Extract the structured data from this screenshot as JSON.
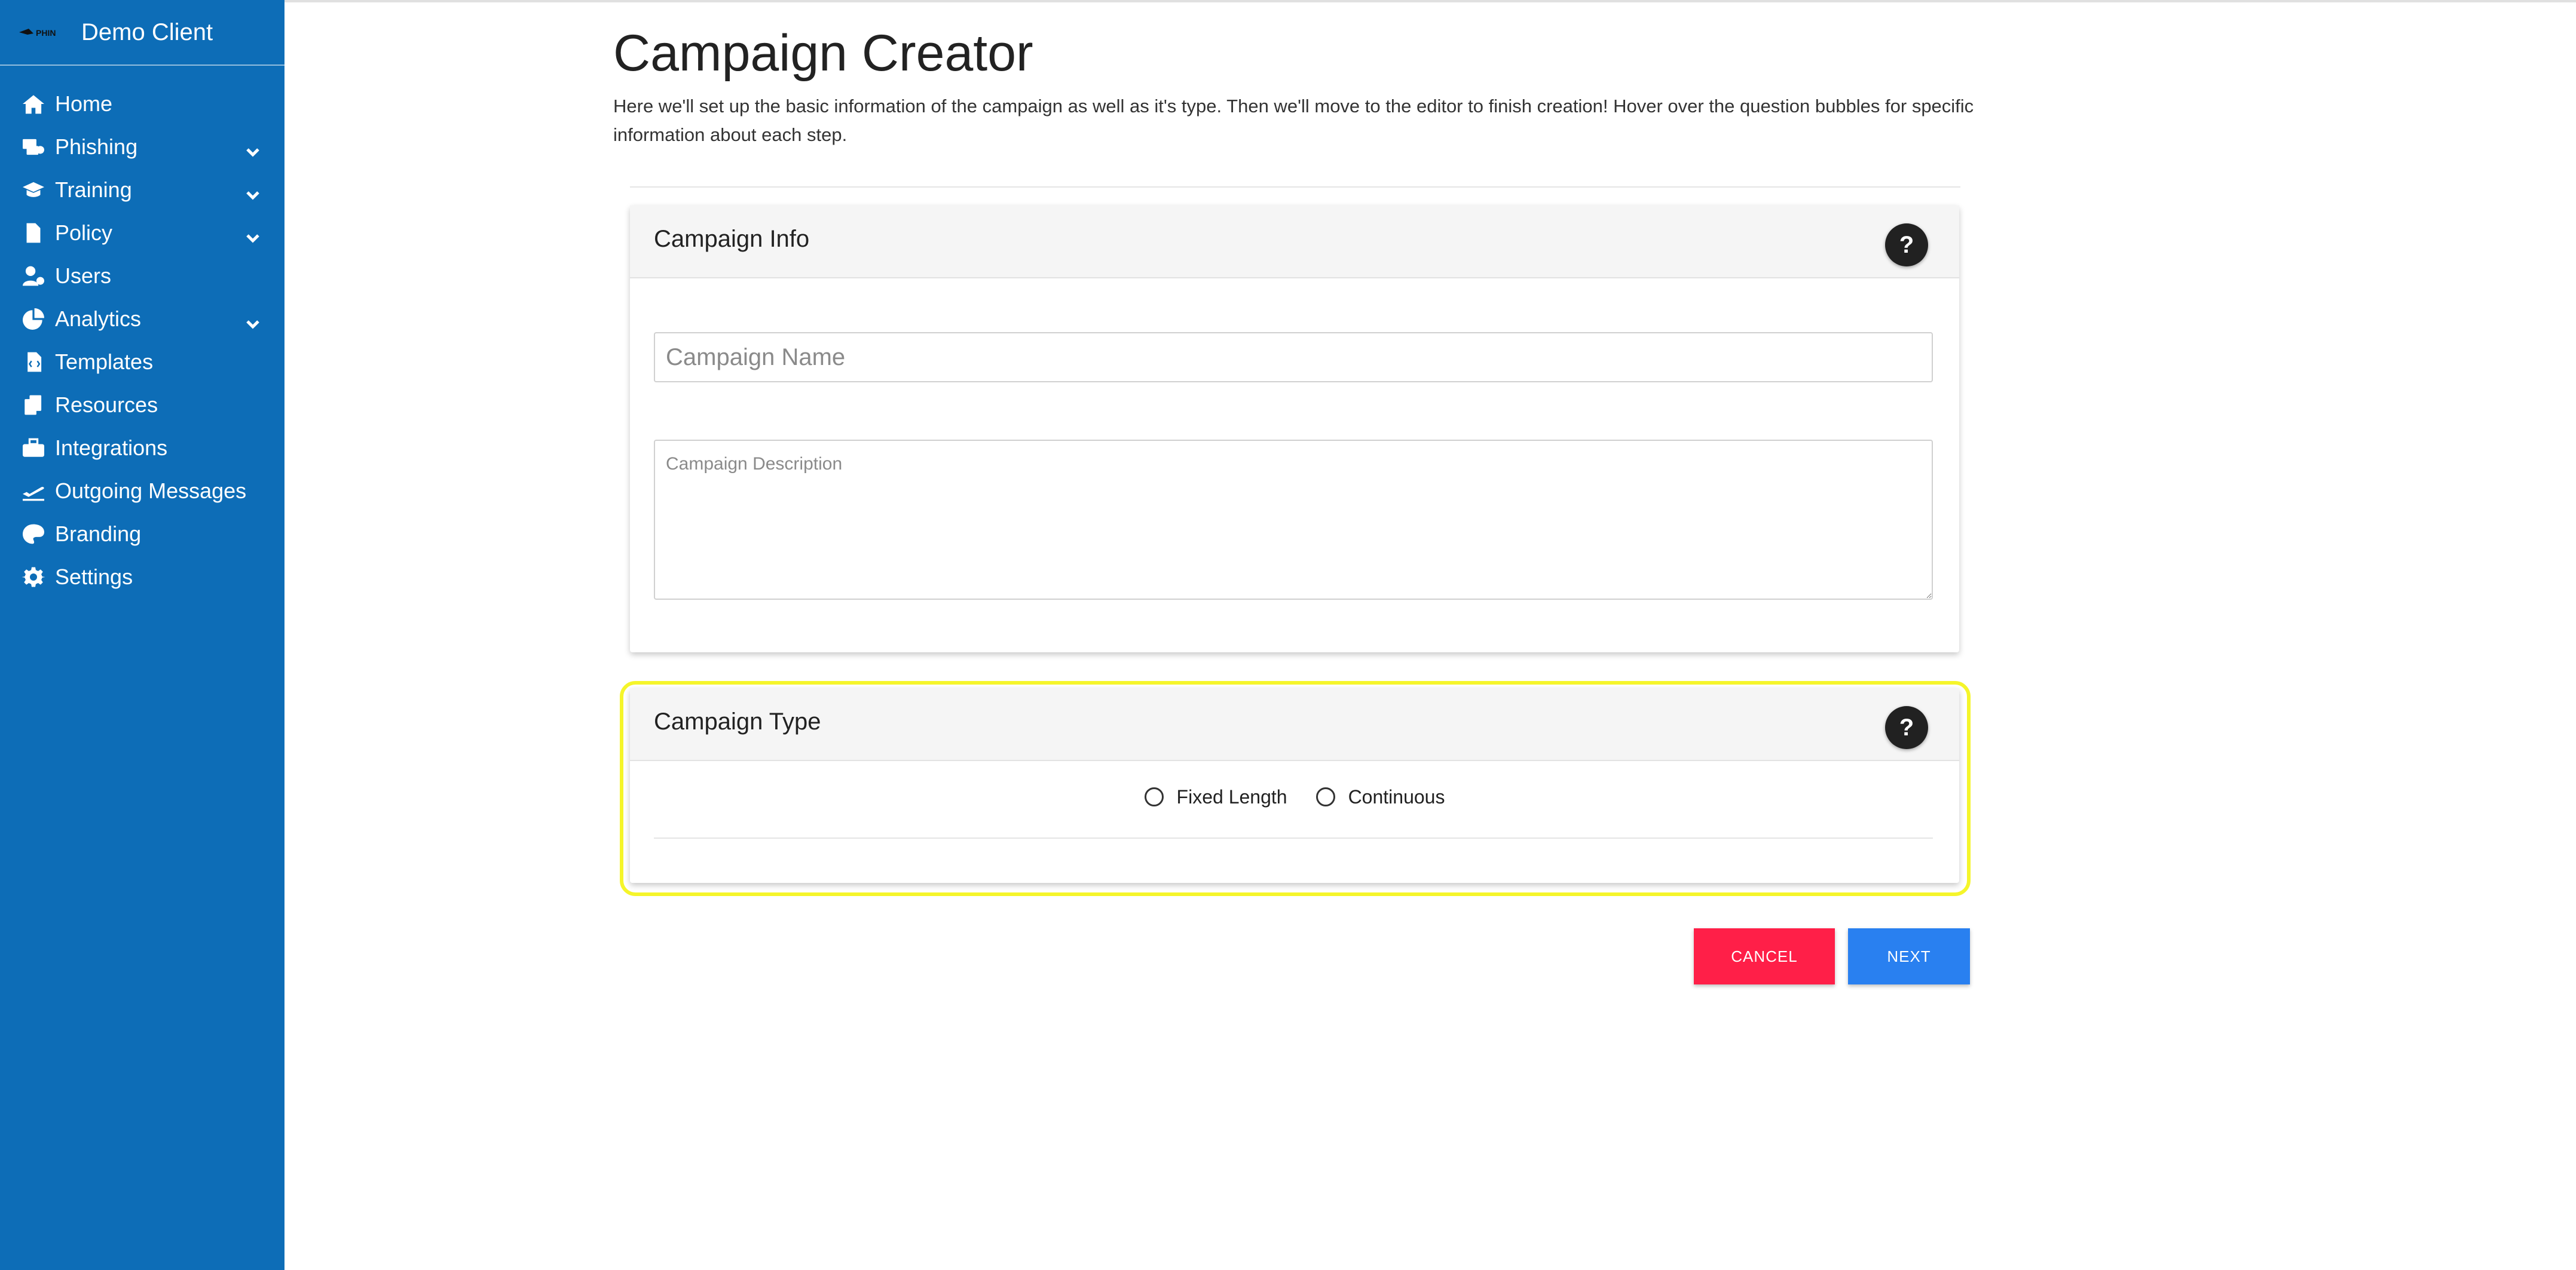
{
  "sidebar": {
    "brand_logo_text": "PHIN",
    "brand_name": "Demo Client",
    "items": [
      {
        "label": "Home",
        "icon": "home-icon",
        "has_submenu": false
      },
      {
        "label": "Phishing",
        "icon": "phishing-icon",
        "has_submenu": true
      },
      {
        "label": "Training",
        "icon": "graduation-cap-icon",
        "has_submenu": true
      },
      {
        "label": "Policy",
        "icon": "file-icon",
        "has_submenu": true
      },
      {
        "label": "Users",
        "icon": "user-gear-icon",
        "has_submenu": false
      },
      {
        "label": "Analytics",
        "icon": "pie-chart-icon",
        "has_submenu": true
      },
      {
        "label": "Templates",
        "icon": "file-code-icon",
        "has_submenu": false
      },
      {
        "label": "Resources",
        "icon": "copy-icon",
        "has_submenu": false
      },
      {
        "label": "Integrations",
        "icon": "toolbox-icon",
        "has_submenu": false
      },
      {
        "label": "Outgoing Messages",
        "icon": "plane-departure-icon",
        "has_submenu": false
      },
      {
        "label": "Branding",
        "icon": "palette-icon",
        "has_submenu": false
      },
      {
        "label": "Settings",
        "icon": "gear-icon",
        "has_submenu": false
      }
    ]
  },
  "main": {
    "title": "Campaign Creator",
    "description": "Here we'll set up the basic information of the campaign as well as it's type. Then we'll move to the editor to finish creation! Hover over the question bubbles for specific information about each step.",
    "campaign_info": {
      "title": "Campaign Info",
      "help_label": "?",
      "name_placeholder": "Campaign Name",
      "name_value": "",
      "description_placeholder": "Campaign Description",
      "description_value": ""
    },
    "campaign_type": {
      "title": "Campaign Type",
      "help_label": "?",
      "options": [
        "Fixed Length",
        "Continuous"
      ],
      "selected": null
    },
    "buttons": {
      "cancel": "CANCEL",
      "next": "NEXT"
    }
  },
  "colors": {
    "sidebar": "#0d6db7",
    "cancel": "#ff1f48",
    "next": "#2980f0",
    "highlight": "#f5f52a"
  }
}
